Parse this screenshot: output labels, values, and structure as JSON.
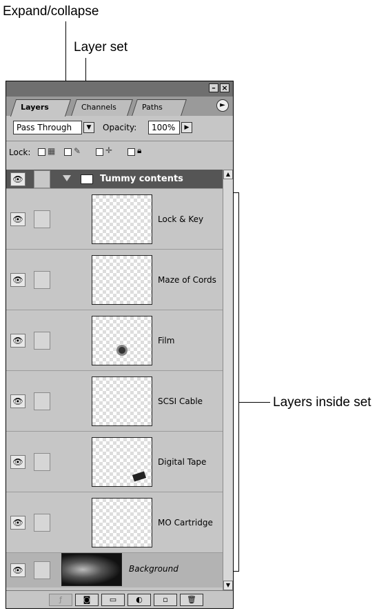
{
  "annotations": {
    "expand_collapse": "Expand/collapse",
    "layer_set": "Layer set",
    "layers_inside_set": "Layers inside set"
  },
  "panel": {
    "tabs": [
      "Layers",
      "Channels",
      "Paths"
    ],
    "active_tab": "Layers",
    "blend_mode": "Pass Through",
    "opacity_label": "Opacity:",
    "opacity_value": "100%",
    "lock_label": "Lock:",
    "set_name": "Tummy contents",
    "layers": [
      {
        "name": "Lock & Key"
      },
      {
        "name": "Maze of Cords"
      },
      {
        "name": "Film"
      },
      {
        "name": "SCSI Cable"
      },
      {
        "name": "Digital Tape"
      },
      {
        "name": "MO Cartridge"
      }
    ],
    "background_name": "Background"
  }
}
